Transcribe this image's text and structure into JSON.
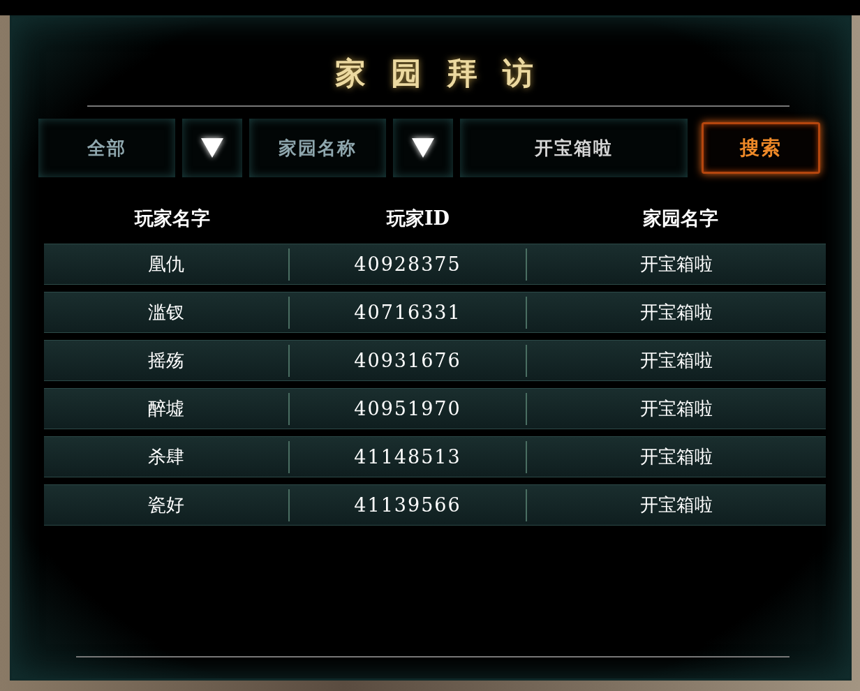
{
  "window": {
    "title": "家园拜访"
  },
  "filters": [
    {
      "value": "全部"
    },
    {
      "value": "家园名称"
    }
  ],
  "search": {
    "value": "开宝箱啦",
    "button": "搜索"
  },
  "table": {
    "columns": [
      "玩家名字",
      "玩家ID",
      "家园名字"
    ],
    "rows": [
      [
        "凰仇",
        "40928375",
        "开宝箱啦"
      ],
      [
        "滥钗",
        "40716331",
        "开宝箱啦"
      ],
      [
        "摇殇",
        "40931676",
        "开宝箱啦"
      ],
      [
        "醉墟",
        "40951970",
        "开宝箱啦"
      ],
      [
        "杀肆",
        "41148513",
        "开宝箱啦"
      ],
      [
        "瓷好",
        "41139566",
        "开宝箱啦"
      ]
    ]
  }
}
